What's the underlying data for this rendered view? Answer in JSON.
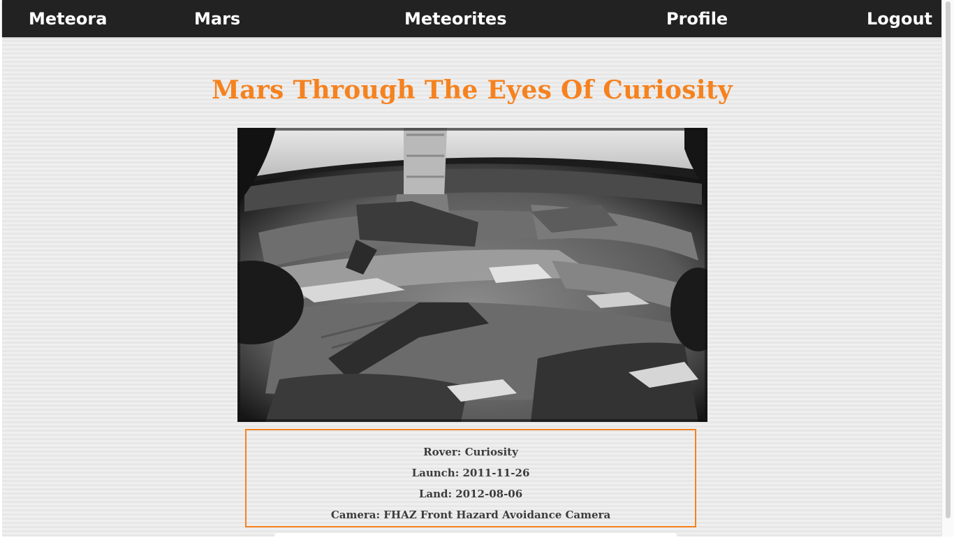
{
  "nav": {
    "items": [
      {
        "label": "Meteora"
      },
      {
        "label": "Mars"
      },
      {
        "label": "Meteorites"
      },
      {
        "label": "Profile"
      },
      {
        "label": "Logout"
      }
    ]
  },
  "main": {
    "title": "Mars Through The Eyes Of Curiosity",
    "photo": {
      "description_icon": "rover-hazcam-photo"
    },
    "info": {
      "rover": "Rover: Curiosity",
      "launch": "Launch: 2011-11-26",
      "land": "Land: 2012-08-06",
      "camera": "Camera: FHAZ Front Hazard Avoidance Camera"
    }
  },
  "colors": {
    "accent": "#f5821f",
    "navbar": "#222222",
    "text": "#3c3c3c"
  }
}
